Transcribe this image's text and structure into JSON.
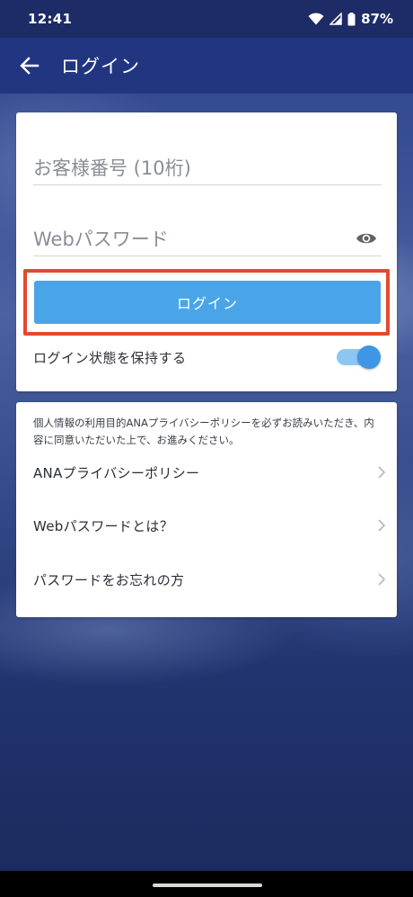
{
  "status_bar": {
    "time": "12:41",
    "battery": "87%",
    "icons": [
      "wifi-icon",
      "cell-signal-icon",
      "battery-icon"
    ]
  },
  "app_bar": {
    "title": "ログイン",
    "back_icon": "arrow-left-icon"
  },
  "login_form": {
    "customer_number_placeholder": "お客様番号 (10桁)",
    "customer_number_value": "",
    "password_placeholder": "Webパスワード",
    "password_value": "",
    "show_password_icon": "eye-icon",
    "login_button": "ログイン",
    "keep_logged_in_label": "ログイン状態を保持する",
    "keep_logged_in": true
  },
  "info_card": {
    "notice": "個人情報の利用目的ANAプライバシーポリシーを必ずお読みいただき、内容に同意いただいた上で、お進みください。",
    "links": [
      {
        "label": "ANAプライバシーポリシー"
      },
      {
        "label": "Webパスワードとは？"
      },
      {
        "label": "パスワードをお忘れの方"
      }
    ]
  },
  "colors": {
    "app_bar": "#223580",
    "login_button": "#4aa5e8",
    "highlight": "#e34a2b",
    "toggle": "#3d96e6"
  }
}
